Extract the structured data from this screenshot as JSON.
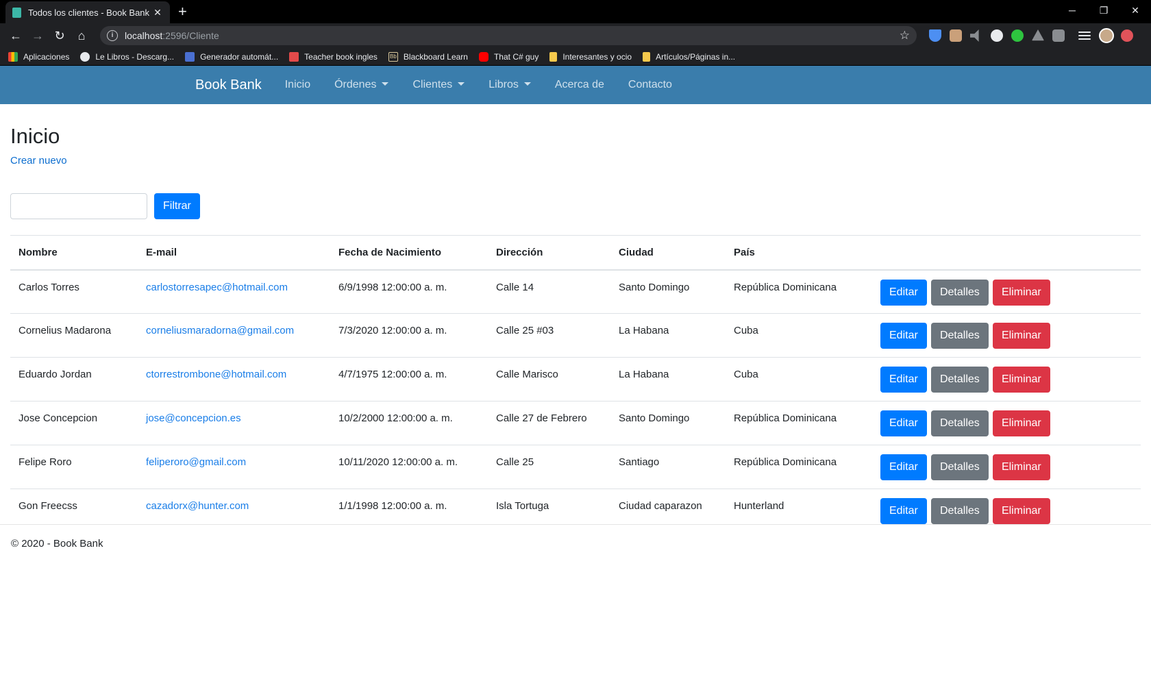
{
  "browser": {
    "tab_title": "Todos los clientes - Book Bank",
    "tab_close": "✕",
    "new_tab": "+",
    "url_host": "localhost",
    "url_path": ":2596/Cliente",
    "bookmarks": [
      {
        "label": "Aplicaciones",
        "color": "#f4b400"
      },
      {
        "label": "Le Libros - Descarg...",
        "color": "#ffffff"
      },
      {
        "label": "Generador automát...",
        "color": "#4a6fd1"
      },
      {
        "label": "Teacher book ingles",
        "color": "#e34a4a"
      },
      {
        "label": "Blackboard Learn",
        "color": "#d9c89c"
      },
      {
        "label": "That C# guy",
        "color": "#ff0000"
      },
      {
        "label": "Interesantes y ocio",
        "color": "#f6c94c"
      },
      {
        "label": "Artículos/Páginas in...",
        "color": "#f6c94c"
      }
    ]
  },
  "navbar": {
    "brand": "Book Bank",
    "links": [
      "Inicio",
      "Órdenes",
      "Clientes",
      "Libros",
      "Acerca de",
      "Contacto"
    ]
  },
  "main": {
    "title": "Inicio",
    "create_link": "Crear nuevo",
    "filter_placeholder": "",
    "filter_button": "Filtrar"
  },
  "table": {
    "headers": [
      "Nombre",
      "E-mail",
      "Fecha de Nacimiento",
      "Dirección",
      "Ciudad",
      "País"
    ],
    "rows": [
      {
        "nombre": "Carlos Torres",
        "email": "carlostorresapec@hotmail.com",
        "fecha": "6/9/1998 12:00:00 a. m.",
        "direccion": "Calle 14",
        "ciudad": "Santo Domingo",
        "pais": "República Dominicana"
      },
      {
        "nombre": "Cornelius Madarona",
        "email": "corneliusmaradorna@gmail.com",
        "fecha": "7/3/2020 12:00:00 a. m.",
        "direccion": "Calle 25 #03",
        "ciudad": "La Habana",
        "pais": "Cuba"
      },
      {
        "nombre": "Eduardo Jordan",
        "email": "ctorrestrombone@hotmail.com",
        "fecha": "4/7/1975 12:00:00 a. m.",
        "direccion": "Calle Marisco",
        "ciudad": "La Habana",
        "pais": "Cuba"
      },
      {
        "nombre": "Jose Concepcion",
        "email": "jose@concepcion.es",
        "fecha": "10/2/2000 12:00:00 a. m.",
        "direccion": "Calle 27 de Febrero",
        "ciudad": "Santo Domingo",
        "pais": "República Dominicana"
      },
      {
        "nombre": "Felipe Roro",
        "email": "feliperoro@gmail.com",
        "fecha": "10/11/2020 12:00:00 a. m.",
        "direccion": "Calle 25",
        "ciudad": "Santiago",
        "pais": "República Dominicana"
      },
      {
        "nombre": "Gon Freecss",
        "email": "cazadorx@hunter.com",
        "fecha": "1/1/1998 12:00:00 a. m.",
        "direccion": "Isla Tortuga",
        "ciudad": "Ciudad caparazon",
        "pais": "Hunterland"
      }
    ],
    "actions": {
      "edit": "Editar",
      "details": "Detalles",
      "delete": "Eliminar"
    }
  },
  "footer": {
    "text": "© 2020 - Book Bank"
  },
  "colors": {
    "navbar": "#3a7dac",
    "primary": "#007bff",
    "secondary": "#6c757d",
    "danger": "#dc3545"
  }
}
